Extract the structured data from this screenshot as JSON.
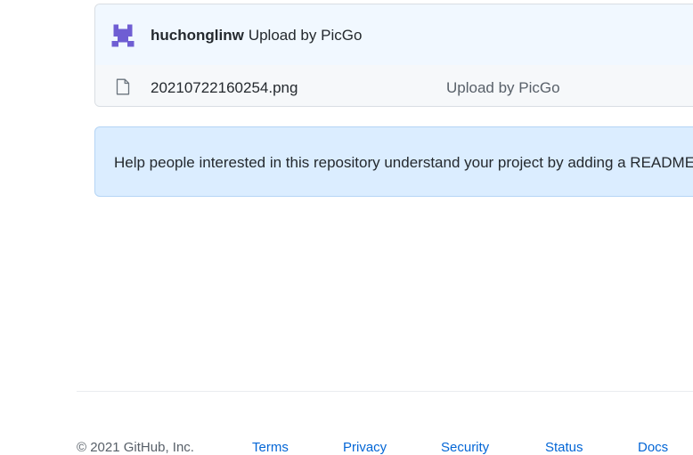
{
  "commit": {
    "author": "huchonglinw",
    "message": "Upload by PicGo",
    "avatar_icon": "identicon-avatar",
    "avatar_color": "#6f5ed3"
  },
  "files": [
    {
      "icon": "file-icon",
      "name": "20210722160254.png",
      "commit_message": "Upload by PicGo"
    }
  ],
  "readme_prompt": {
    "text": "Help people interested in this repository understand your project by adding a README."
  },
  "footer": {
    "copyright": "© 2021 GitHub, Inc.",
    "links": [
      "Terms",
      "Privacy",
      "Security",
      "Status",
      "Docs"
    ]
  },
  "colors": {
    "link": "#0366d6",
    "readme_bg": "#dbedff",
    "commit_bg": "#f1f8ff"
  }
}
